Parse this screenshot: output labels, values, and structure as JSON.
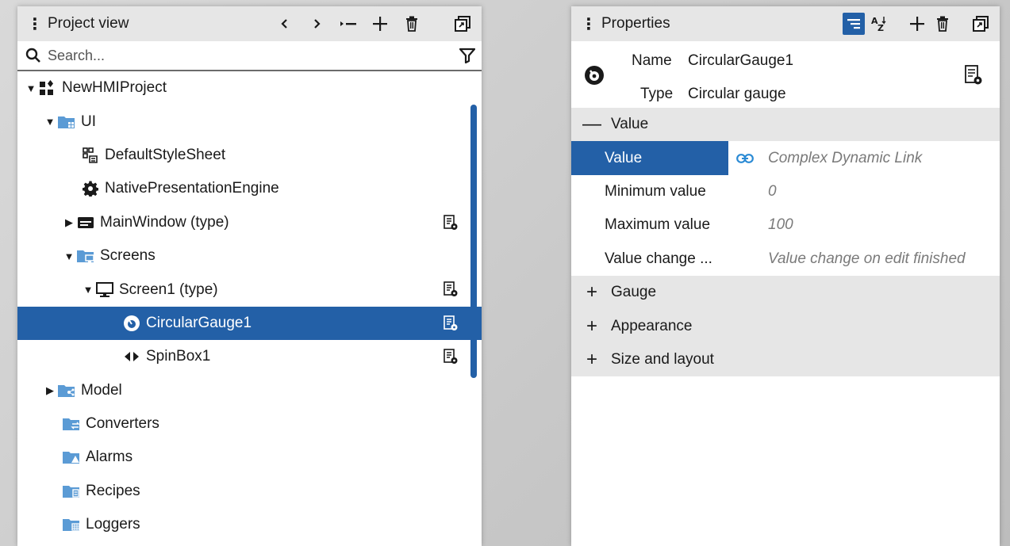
{
  "project_view": {
    "title": "Project view",
    "search_placeholder": "Search...",
    "tree": [
      {
        "label": "NewHMIProject",
        "icon": "project-icon",
        "expanded": true
      },
      {
        "label": "UI",
        "icon": "ui-folder-icon",
        "expanded": true
      },
      {
        "label": "DefaultStyleSheet",
        "icon": "stylesheet-icon"
      },
      {
        "label": "NativePresentationEngine",
        "icon": "gear-icon"
      },
      {
        "label": "MainWindow (type)",
        "icon": "window-icon",
        "expanded": false
      },
      {
        "label": "Screens",
        "icon": "screens-folder-icon",
        "expanded": true
      },
      {
        "label": "Screen1 (type)",
        "icon": "monitor-icon",
        "expanded": true
      },
      {
        "label": "CircularGauge1",
        "icon": "gauge-icon",
        "selected": true
      },
      {
        "label": "SpinBox1",
        "icon": "spinbox-icon"
      },
      {
        "label": "Model",
        "icon": "model-folder-icon",
        "expanded": false
      },
      {
        "label": "Converters",
        "icon": "converters-folder-icon"
      },
      {
        "label": "Alarms",
        "icon": "alarms-folder-icon"
      },
      {
        "label": "Recipes",
        "icon": "recipes-folder-icon"
      },
      {
        "label": "Loggers",
        "icon": "loggers-folder-icon"
      }
    ]
  },
  "properties": {
    "title": "Properties",
    "name_label": "Name",
    "name_value": "CircularGauge1",
    "type_label": "Type",
    "type_value": "Circular gauge",
    "groups": {
      "value": {
        "label": "Value",
        "expanded": true
      },
      "gauge": {
        "label": "Gauge",
        "expanded": false
      },
      "appearance": {
        "label": "Appearance",
        "expanded": false
      },
      "size_layout": {
        "label": "Size and layout",
        "expanded": false
      }
    },
    "rows": [
      {
        "name": "Value",
        "value": "Complex Dynamic Link",
        "selected": true
      },
      {
        "name": "Minimum value",
        "value": "0"
      },
      {
        "name": "Maximum value",
        "value": "100"
      },
      {
        "name": "Value change ...",
        "value": "Value change on edit finished"
      }
    ]
  },
  "colors": {
    "accent": "#2360a7",
    "folder": "#5b9bd5",
    "header_bg": "#e6e6e6"
  }
}
